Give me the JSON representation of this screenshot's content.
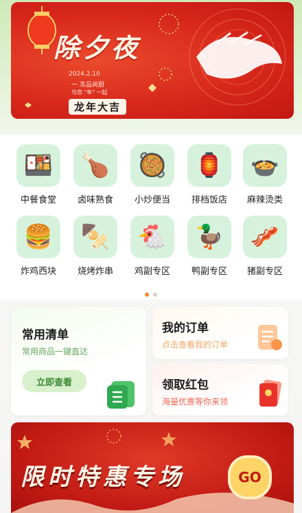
{
  "banner": {
    "title": "除夕夜",
    "date": "2024.2.10",
    "line1": "一 冻品尚厨",
    "line2": "与您 \"年\" 一起",
    "slogan": "龙年大吉"
  },
  "categories": [
    {
      "label": "中餐食堂",
      "icon": "🍱",
      "bg": "#d6f2dc"
    },
    {
      "label": "卤味熟食",
      "icon": "🍗",
      "bg": "#d6f2dc"
    },
    {
      "label": "小炒便当",
      "icon": "🥘",
      "bg": "#d6f2dc"
    },
    {
      "label": "排档饭店",
      "icon": "🏮",
      "bg": "#d6f2dc"
    },
    {
      "label": "麻辣烫类",
      "icon": "🍲",
      "bg": "#d6f2dc"
    },
    {
      "label": "炸鸡西块",
      "icon": "🍔",
      "bg": "#d6f2dc"
    },
    {
      "label": "烧烤炸串",
      "icon": "🍢",
      "bg": "#d6f2dc"
    },
    {
      "label": "鸡副专区",
      "icon": "🐔",
      "bg": "#d6f2dc"
    },
    {
      "label": "鸭副专区",
      "icon": "🦆",
      "bg": "#d6f2dc"
    },
    {
      "label": "猪副专区",
      "icon": "🥓",
      "bg": "#d6f2dc"
    }
  ],
  "common_list": {
    "title": "常用清单",
    "subtitle": "常用商品一键直达",
    "button": "立即查看"
  },
  "my_orders": {
    "title": "我的订单",
    "subtitle": "点击查看我的订单"
  },
  "red_packet": {
    "title": "领取红包",
    "subtitle": "海量优惠等你来领"
  },
  "promo": {
    "title": "限时特惠专场",
    "go": "GO"
  },
  "colors": {
    "green_accent": "#3e8a35",
    "orange_accent": "#f08a2c",
    "red_accent": "#d8281c"
  }
}
